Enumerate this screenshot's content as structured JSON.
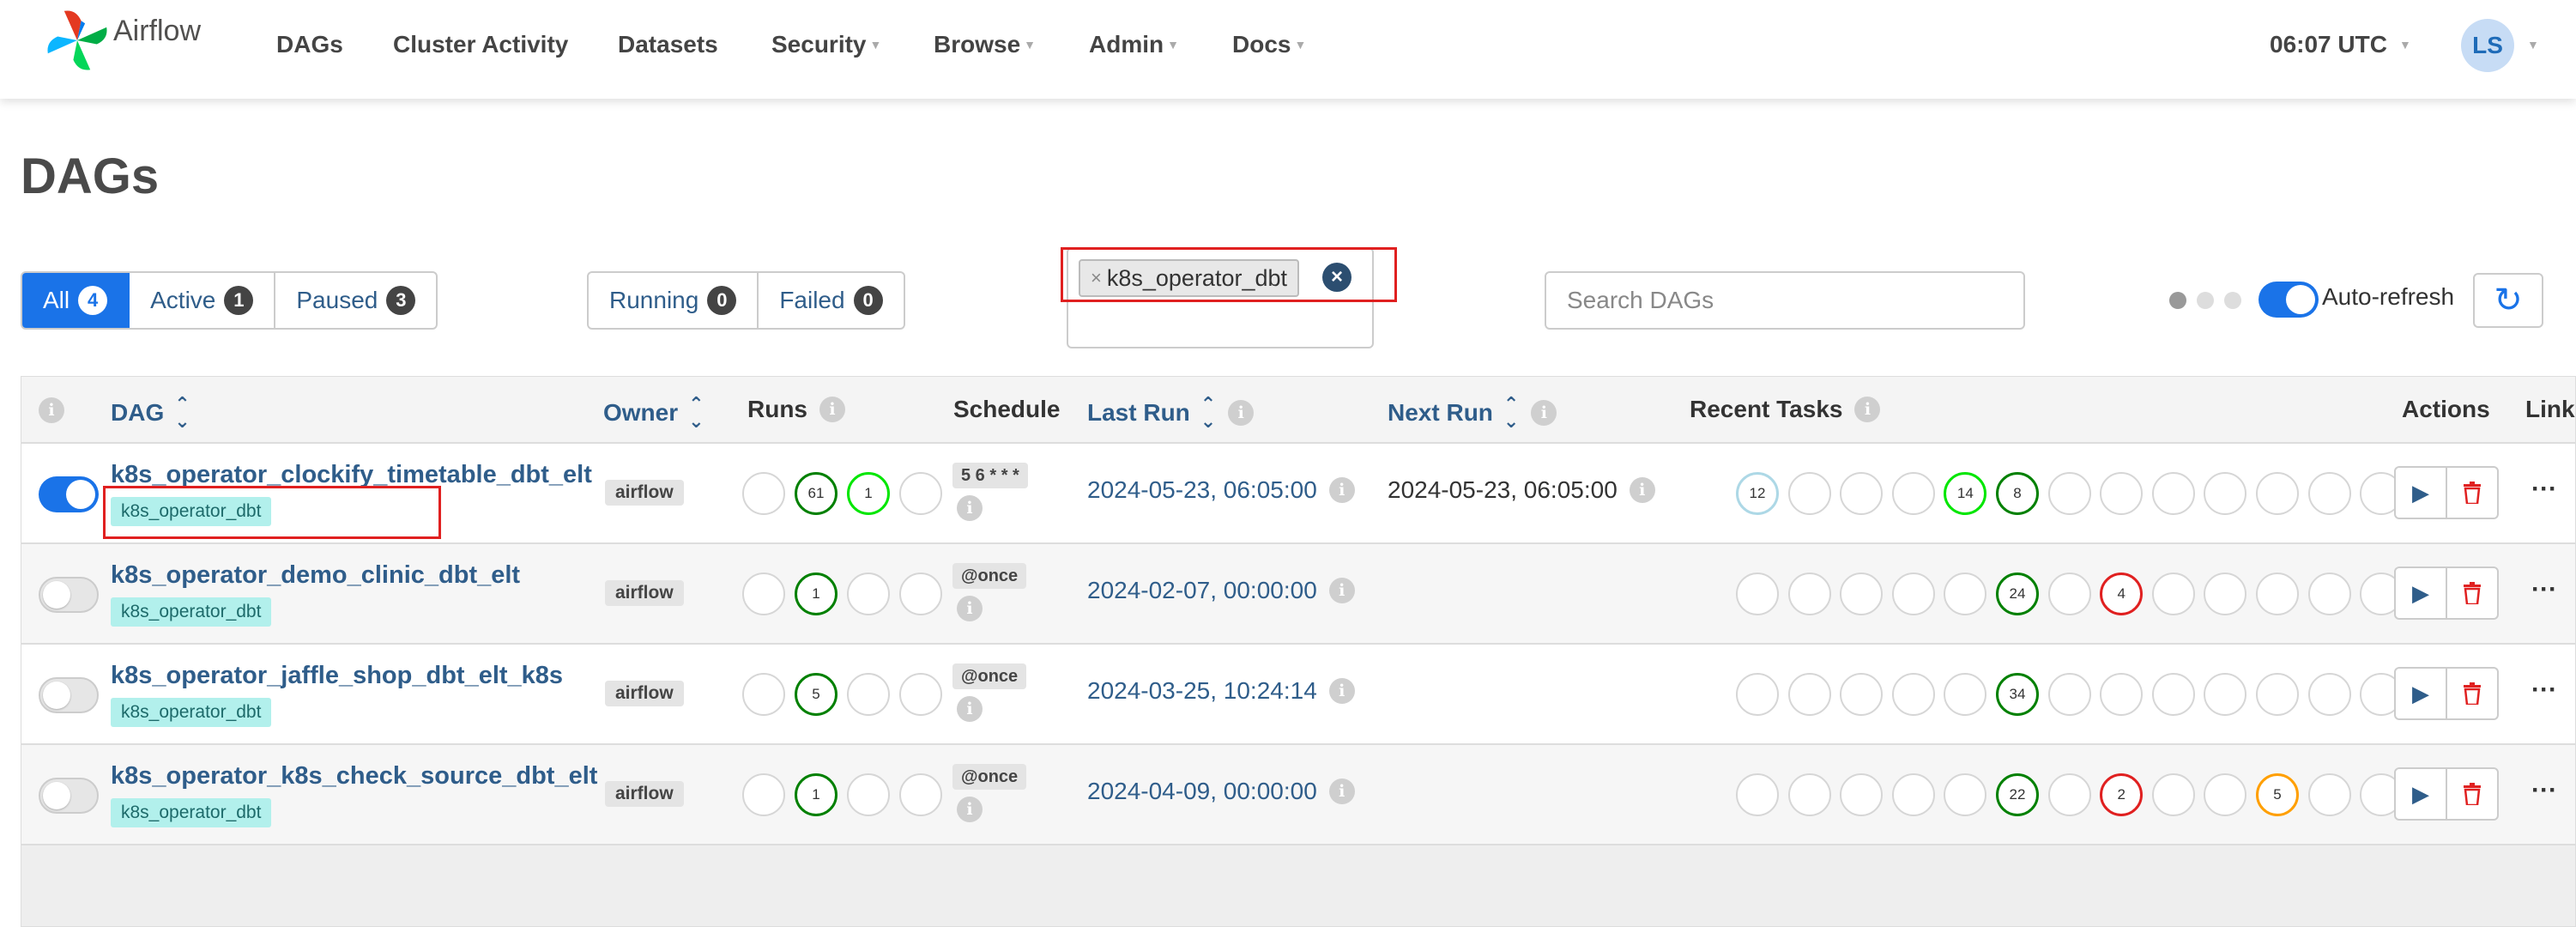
{
  "nav": {
    "brand": "Airflow",
    "items": [
      {
        "label": "DAGs",
        "caret": false
      },
      {
        "label": "Cluster Activity",
        "caret": false
      },
      {
        "label": "Datasets",
        "caret": false
      },
      {
        "label": "Security",
        "caret": true
      },
      {
        "label": "Browse",
        "caret": true
      },
      {
        "label": "Admin",
        "caret": true
      },
      {
        "label": "Docs",
        "caret": true
      }
    ],
    "clock": "06:07 UTC",
    "user_initials": "LS"
  },
  "page": {
    "title": "DAGs"
  },
  "status_filter": [
    {
      "label": "All",
      "count": "4",
      "active": true
    },
    {
      "label": "Active",
      "count": "1",
      "active": false
    },
    {
      "label": "Paused",
      "count": "3",
      "active": false
    }
  ],
  "run_filter": [
    {
      "label": "Running",
      "count": "0"
    },
    {
      "label": "Failed",
      "count": "0"
    }
  ],
  "tag_filter": {
    "selected_tag": "k8s_operator_dbt",
    "remove_glyph": "×",
    "clear_glyph": "×"
  },
  "search": {
    "placeholder": "Search DAGs"
  },
  "auto_refresh": {
    "label": "Auto-refresh",
    "enabled": true
  },
  "colors": {
    "primary": "#1a73e8",
    "link": "#2f5d8a",
    "success": "#008000",
    "running": "#00e600",
    "failed": "#e02020",
    "upstream_failed": "#ff9f00",
    "queued": "#add8e6",
    "tag_bg": "#b2f0ec",
    "highlight": "#e02020"
  },
  "table": {
    "headers": {
      "dag": "DAG",
      "owner": "Owner",
      "runs": "Runs",
      "schedule": "Schedule",
      "last_run": "Last Run",
      "next_run": "Next Run",
      "recent_tasks": "Recent Tasks",
      "actions": "Actions",
      "links": "Links"
    },
    "rows": [
      {
        "dag_id": "k8s_operator_clockify_timetable_dbt_elt",
        "tag": "k8s_operator_dbt",
        "paused": false,
        "owner": "airflow",
        "runs": [
          {
            "label": "",
            "state": "none"
          },
          {
            "label": "61",
            "state": "success"
          },
          {
            "label": "1",
            "state": "running"
          },
          {
            "label": "",
            "state": "none"
          }
        ],
        "schedule": "5 6 * * *",
        "last_run": "2024-05-23, 06:05:00",
        "next_run": "2024-05-23, 06:05:00",
        "recent_tasks": [
          {
            "label": "12",
            "state": "queued"
          },
          {
            "label": "",
            "state": "none"
          },
          {
            "label": "",
            "state": "none"
          },
          {
            "label": "",
            "state": "none"
          },
          {
            "label": "14",
            "state": "running"
          },
          {
            "label": "8",
            "state": "success"
          },
          {
            "label": "",
            "state": "none"
          },
          {
            "label": "",
            "state": "none"
          },
          {
            "label": "",
            "state": "none"
          },
          {
            "label": "",
            "state": "none"
          },
          {
            "label": "",
            "state": "none"
          },
          {
            "label": "",
            "state": "none"
          },
          {
            "label": "",
            "state": "none"
          },
          {
            "label": "",
            "state": "none"
          }
        ]
      },
      {
        "dag_id": "k8s_operator_demo_clinic_dbt_elt",
        "tag": "k8s_operator_dbt",
        "paused": true,
        "owner": "airflow",
        "runs": [
          {
            "label": "",
            "state": "none"
          },
          {
            "label": "1",
            "state": "success"
          },
          {
            "label": "",
            "state": "none"
          },
          {
            "label": "",
            "state": "none"
          }
        ],
        "schedule": "@once",
        "last_run": "2024-02-07, 00:00:00",
        "next_run": "",
        "recent_tasks": [
          {
            "label": "",
            "state": "none"
          },
          {
            "label": "",
            "state": "none"
          },
          {
            "label": "",
            "state": "none"
          },
          {
            "label": "",
            "state": "none"
          },
          {
            "label": "",
            "state": "none"
          },
          {
            "label": "24",
            "state": "success"
          },
          {
            "label": "",
            "state": "none"
          },
          {
            "label": "4",
            "state": "failed"
          },
          {
            "label": "",
            "state": "none"
          },
          {
            "label": "",
            "state": "none"
          },
          {
            "label": "",
            "state": "none"
          },
          {
            "label": "",
            "state": "none"
          },
          {
            "label": "",
            "state": "none"
          },
          {
            "label": "",
            "state": "none"
          }
        ]
      },
      {
        "dag_id": "k8s_operator_jaffle_shop_dbt_elt_k8s",
        "tag": "k8s_operator_dbt",
        "paused": true,
        "owner": "airflow",
        "runs": [
          {
            "label": "",
            "state": "none"
          },
          {
            "label": "5",
            "state": "success"
          },
          {
            "label": "",
            "state": "none"
          },
          {
            "label": "",
            "state": "none"
          }
        ],
        "schedule": "@once",
        "last_run": "2024-03-25, 10:24:14",
        "next_run": "",
        "recent_tasks": [
          {
            "label": "",
            "state": "none"
          },
          {
            "label": "",
            "state": "none"
          },
          {
            "label": "",
            "state": "none"
          },
          {
            "label": "",
            "state": "none"
          },
          {
            "label": "",
            "state": "none"
          },
          {
            "label": "34",
            "state": "success"
          },
          {
            "label": "",
            "state": "none"
          },
          {
            "label": "",
            "state": "none"
          },
          {
            "label": "",
            "state": "none"
          },
          {
            "label": "",
            "state": "none"
          },
          {
            "label": "",
            "state": "none"
          },
          {
            "label": "",
            "state": "none"
          },
          {
            "label": "",
            "state": "none"
          },
          {
            "label": "",
            "state": "none"
          }
        ]
      },
      {
        "dag_id": "k8s_operator_k8s_check_source_dbt_elt",
        "tag": "k8s_operator_dbt",
        "paused": true,
        "owner": "airflow",
        "runs": [
          {
            "label": "",
            "state": "none"
          },
          {
            "label": "1",
            "state": "success"
          },
          {
            "label": "",
            "state": "none"
          },
          {
            "label": "",
            "state": "none"
          }
        ],
        "schedule": "@once",
        "last_run": "2024-04-09, 00:00:00",
        "next_run": "",
        "recent_tasks": [
          {
            "label": "",
            "state": "none"
          },
          {
            "label": "",
            "state": "none"
          },
          {
            "label": "",
            "state": "none"
          },
          {
            "label": "",
            "state": "none"
          },
          {
            "label": "",
            "state": "none"
          },
          {
            "label": "22",
            "state": "success"
          },
          {
            "label": "",
            "state": "none"
          },
          {
            "label": "2",
            "state": "failed"
          },
          {
            "label": "",
            "state": "none"
          },
          {
            "label": "",
            "state": "none"
          },
          {
            "label": "5",
            "state": "upstream_failed"
          },
          {
            "label": "",
            "state": "none"
          },
          {
            "label": "",
            "state": "none"
          },
          {
            "label": "",
            "state": "none"
          }
        ]
      }
    ]
  }
}
